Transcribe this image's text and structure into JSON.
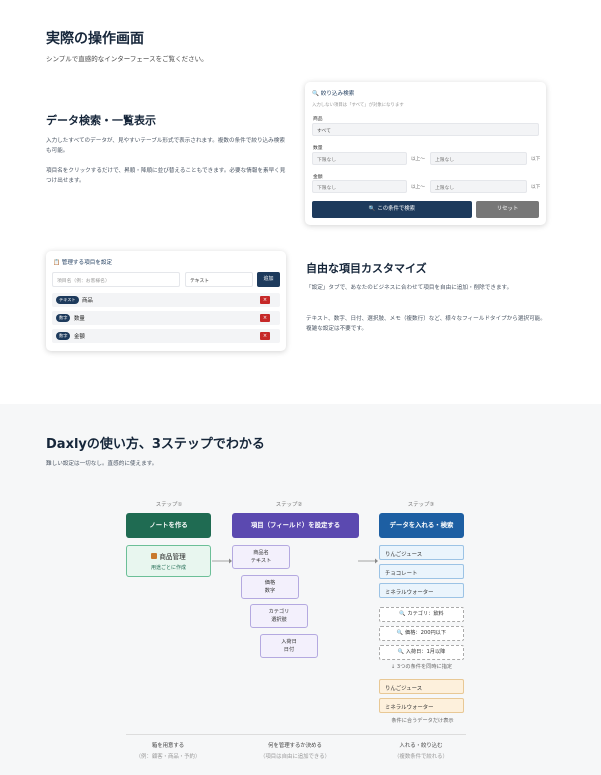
{
  "hero": {
    "title": "実際の操作画面",
    "subtitle": "シンプルで直感的なインターフェースをご覧ください。"
  },
  "search_section": {
    "title": "データ検索・一覧表示",
    "para1": "入力したすべてのデータが、見やすいテーブル形式で表示されます。複数の条件で絞り込み検索も可能。",
    "para2": "項目名をクリックするだけで、昇順・降順に並び替えることもできます。必要な情報を素早く見つけ出せます。"
  },
  "filter_card": {
    "title": "🔍 絞り込み検索",
    "note": "入力しない項目は「すべて」が対象になります",
    "product_label": "商品",
    "product_value": "すべて",
    "qty_label": "数量",
    "amount_label": "金額",
    "min_placeholder": "下限なし",
    "max_placeholder": "上限なし",
    "from_text": "以上〜",
    "to_text": "以下",
    "search_button": "🔍 この条件で検索",
    "reset_button": "リセット"
  },
  "field_card": {
    "title": "📋 管理する項目を設定",
    "name_placeholder": "項目名（例：お客様名）",
    "type_value": "テキスト",
    "add_button": "追加",
    "fields": [
      {
        "type": "テキスト",
        "name": "商品"
      },
      {
        "type": "数字",
        "name": "数量"
      },
      {
        "type": "数字",
        "name": "金額"
      }
    ],
    "delete_label": "×"
  },
  "custom_section": {
    "title": "自由な項目カスタマイズ",
    "para1": "「設定」タブで、あなたのビジネスに合わせて項目を自由に追加・削除できます。",
    "para2": "テキスト、数字、日付、選択肢、メモ（複数行）など、様々なフィールドタイプから選択可能。複雑な設定は不要です。"
  },
  "steps_section": {
    "title": "Daxlyの使い方、3ステップでわかる",
    "subtitle": "難しい設定は一切なし。直感的に使えます。",
    "steps": [
      {
        "label": "ステップ①",
        "title": "ノートを作る",
        "color": "#1f6b52"
      },
      {
        "label": "ステップ②",
        "title": "項目（フィールド）を設定する",
        "color": "#5b49b0"
      },
      {
        "label": "ステップ③",
        "title": "データを入れる・検索",
        "color": "#1d5fa3"
      }
    ],
    "note_card": {
      "title": "商品管理",
      "sub": "用途ごとに作成"
    },
    "fields": [
      {
        "name": "商品名",
        "type": "テキスト"
      },
      {
        "name": "価格",
        "type": "数字"
      },
      {
        "name": "カテゴリ",
        "type": "選択肢"
      },
      {
        "name": "入荷日",
        "type": "日付"
      }
    ],
    "data_items": [
      "りんごジュース",
      "チョコレート",
      "ミネラルウォーター"
    ],
    "filters": [
      "🔍 カテゴリ：飲料",
      "🔍 価格：200円以下",
      "🔍 入荷日：1月以降"
    ],
    "filter_note": "↓ 3つの条件を同時に指定",
    "results": [
      "りんごジュース",
      "ミネラルウォーター"
    ],
    "result_note": "条件に合うデータだけ表示",
    "footer": [
      {
        "main": "箱を用意する",
        "sub": "（例：顧客・商品・予約）"
      },
      {
        "main": "何を管理するか決める",
        "sub": "（項目は自由に追加できる）"
      },
      {
        "main": "入れる・絞り込む",
        "sub": "（複数条件で絞れる）"
      }
    ]
  }
}
